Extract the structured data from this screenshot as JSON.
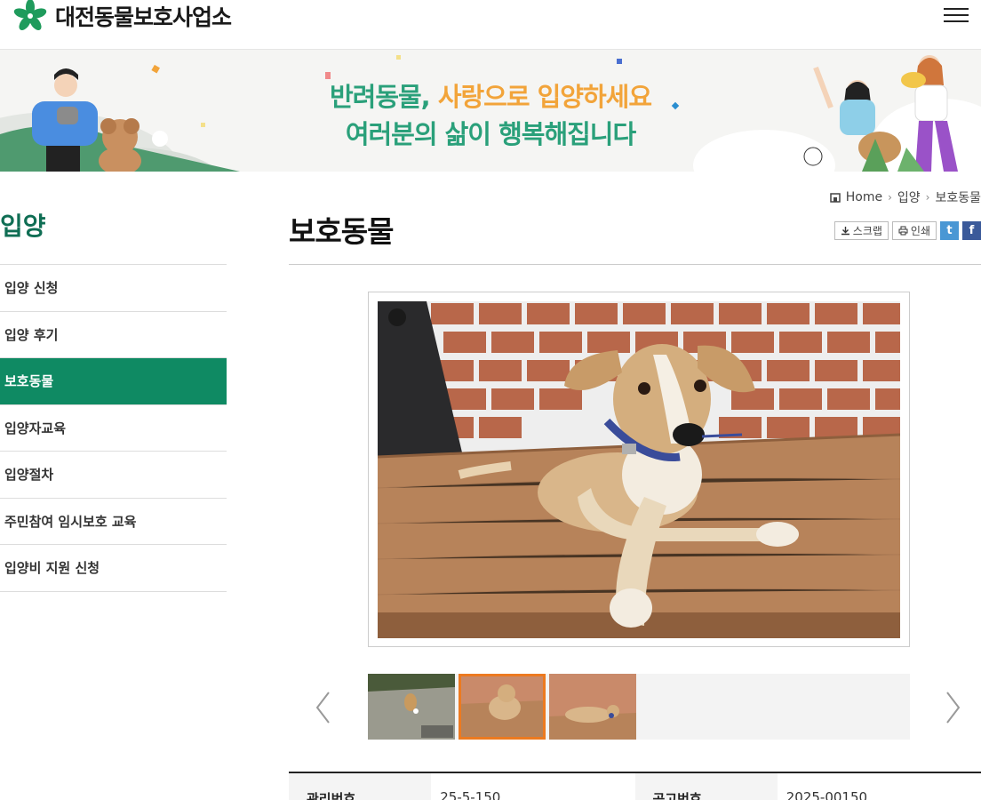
{
  "header": {
    "logo_text": "대전동물보호사업소",
    "menu_icon": "hamburger-icon"
  },
  "banner": {
    "line1_a": "반려동물,",
    "line1_b": "사랑으로 입양하세요",
    "line2": "여러분의 삶이 행복해집니다"
  },
  "sidebar": {
    "title": "입양",
    "items": [
      {
        "label": "입양 신청"
      },
      {
        "label": "입양 후기"
      },
      {
        "label": "보호동물"
      },
      {
        "label": "입양자교육"
      },
      {
        "label": "입양절차"
      },
      {
        "label": "주민참여 임시보호 교육"
      },
      {
        "label": "입양비 지원 신청"
      }
    ],
    "active_index": 2
  },
  "breadcrumb": {
    "home": "Home",
    "level1": "입양",
    "level2": "보호동물"
  },
  "page": {
    "title": "보호동물"
  },
  "utility": {
    "scrap": "스크랩",
    "print": "인쇄",
    "twitter": "t",
    "facebook": "f"
  },
  "gallery": {
    "thumb_count": 3,
    "active_thumb": 1
  },
  "info": {
    "row1": {
      "label1": "관리번호",
      "value1": "25-5-150",
      "label2": "공고번호",
      "value2": "2025-00150"
    }
  },
  "colors": {
    "brand_green": "#0f8a63",
    "title_green": "#0f6e54",
    "banner_green": "#2aa07a",
    "banner_orange": "#f2a43a",
    "thumb_active": "#ec7a20"
  }
}
